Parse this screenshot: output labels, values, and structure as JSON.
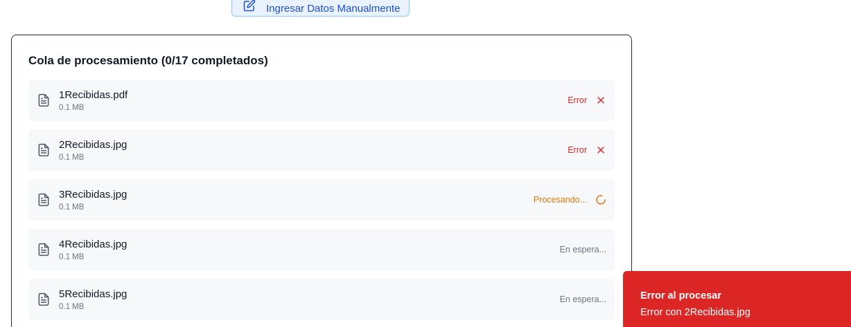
{
  "manual_button": {
    "label": "Ingresar Datos Manualmente",
    "icon": "edit-icon"
  },
  "queue": {
    "title": "Cola de procesamiento (0/17 completados)",
    "items": [
      {
        "name": "1Recibidas.pdf",
        "size": "0.1 MB",
        "status": "Error",
        "status_type": "error",
        "icon": "close-icon"
      },
      {
        "name": "2Recibidas.jpg",
        "size": "0.1 MB",
        "status": "Error",
        "status_type": "error",
        "icon": "close-icon"
      },
      {
        "name": "3Recibidas.jpg",
        "size": "0.1 MB",
        "status": "Procesando...",
        "status_type": "processing",
        "icon": "spinner-icon"
      },
      {
        "name": "4Recibidas.jpg",
        "size": "0.1 MB",
        "status": "En espera...",
        "status_type": "waiting"
      },
      {
        "name": "5Recibidas.jpg",
        "size": "0.1 MB",
        "status": "En espera...",
        "status_type": "waiting"
      }
    ]
  },
  "toast": {
    "title": "Error al procesar",
    "message": "Error con 2Recibidas.jpg"
  },
  "colors": {
    "error": "#dc2626",
    "processing": "#d97706",
    "waiting": "#6b7280",
    "accent": "#1d4ed8"
  }
}
